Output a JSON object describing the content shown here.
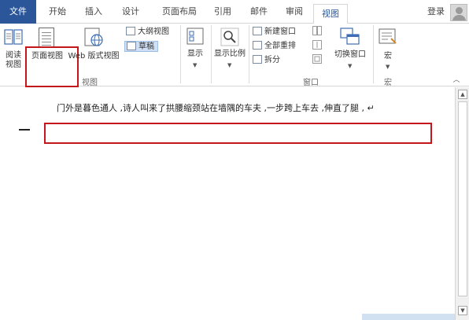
{
  "tabs": {
    "file": "文件",
    "home": "开始",
    "insert": "插入",
    "design": "设计",
    "layout": "页面布局",
    "references": "引用",
    "mailings": "邮件",
    "review": "审阅",
    "view": "视图"
  },
  "account": {
    "login": "登录"
  },
  "ribbon": {
    "views": {
      "read_mode": "阅读视图",
      "print_layout": "页面视图",
      "web_layout": "Web 版式视图",
      "outline": "大纲视图",
      "draft": "草稿",
      "group_label": "视图"
    },
    "show": {
      "label": "显示"
    },
    "zoom": {
      "label": "显示比例"
    },
    "window": {
      "new_window": "新建窗口",
      "arrange_all": "全部重排",
      "split": "拆分",
      "switch_windows": "切换窗口",
      "group_label": "窗口"
    },
    "macros": {
      "label": "宏",
      "group_label": "宏"
    }
  },
  "document": {
    "paragraph": "门外是暮色通人 ,诗人叫来了拱腰缩颈站在墙隅的车夫 ,一步跨上车去 ,伸直了腿 , ↵"
  },
  "colors": {
    "accent": "#2b579a",
    "highlight": "#c4161c"
  }
}
